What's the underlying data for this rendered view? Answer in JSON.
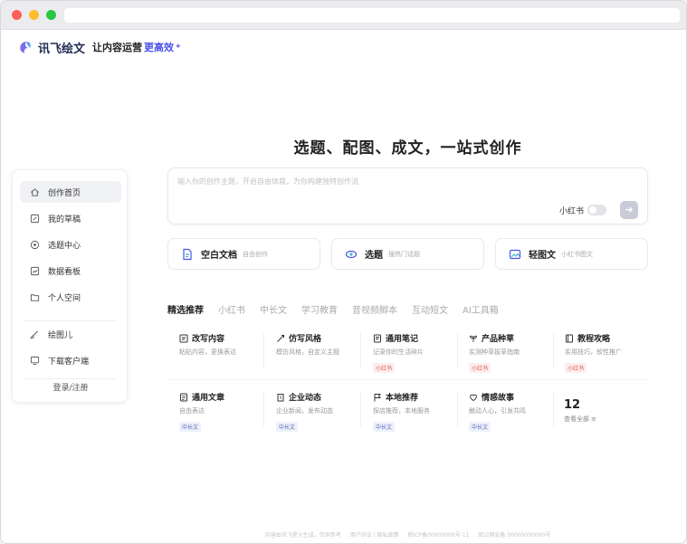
{
  "header": {
    "brand": "讯飞绘文",
    "slogan": "让内容运营",
    "slogan_accent": "更高效",
    "sparkle": "✦"
  },
  "hero": {
    "title": "选题、配图、成文，一站式创作"
  },
  "sidebar": {
    "items": [
      {
        "label": "创作首页",
        "icon": "home-icon"
      },
      {
        "label": "我的草稿",
        "icon": "edit-icon"
      },
      {
        "label": "选题中心",
        "icon": "target-icon"
      },
      {
        "label": "数据看板",
        "icon": "chart-icon"
      },
      {
        "label": "个人空间",
        "icon": "folder-icon"
      },
      {
        "label": "绘图儿",
        "icon": "brush-icon"
      },
      {
        "label": "下载客户端",
        "icon": "download-icon"
      }
    ],
    "login": "登录/注册"
  },
  "input": {
    "placeholder": "输入你的创作主题，开启自由体裁，为你构建独特创作流",
    "toggle_label": "小红书",
    "send_icon": "arrow-right-icon"
  },
  "quick_actions": [
    {
      "title": "空白文档",
      "subtitle": "自由创作",
      "icon": "doc-icon"
    },
    {
      "title": "选题",
      "subtitle": "搜热门话题",
      "icon": "eye-icon"
    },
    {
      "title": "轻图文",
      "subtitle": "小红书图文",
      "icon": "image-icon"
    }
  ],
  "tabs": [
    "精选推荐",
    "小红书",
    "中长文",
    "学习教育",
    "音视频脚本",
    "互动短文",
    "AI工具箱"
  ],
  "cards_row1": [
    {
      "title": "改写内容",
      "desc": "粘贴内容，更换表达",
      "tag": ""
    },
    {
      "title": "仿写风格",
      "desc": "模仿风格，自定义主题",
      "tag": ""
    },
    {
      "title": "通用笔记",
      "desc": "记录你的生活碎片",
      "tag": "小红书"
    },
    {
      "title": "产品种草",
      "desc": "实测种草拔草指南",
      "tag": "小红书"
    },
    {
      "title": "教程攻略",
      "desc": "实用技巧，软性推广",
      "tag": "小红书"
    }
  ],
  "cards_row2": [
    {
      "title": "通用文章",
      "desc": "自由表达",
      "tag": "中长文"
    },
    {
      "title": "企业动态",
      "desc": "企业新闻，发布动态",
      "tag": "中长文"
    },
    {
      "title": "本地推荐",
      "desc": "探店推荐，本地服务",
      "tag": "中长文"
    },
    {
      "title": "情感故事",
      "desc": "触动人心，引发共鸣",
      "tag": "中长文"
    }
  ],
  "more": {
    "count": "12",
    "label": "查看全部"
  },
  "footer": [
    "内容由讯飞星火生成，仅供参考",
    "用户协议 | 隐私政策",
    "皖ICP备00000000号-11",
    "皖公网安备 00000000000号"
  ],
  "colors": {
    "accent": "#4a55e8",
    "tag_red": "#d95656",
    "tag_blue": "#5a6bb4"
  }
}
